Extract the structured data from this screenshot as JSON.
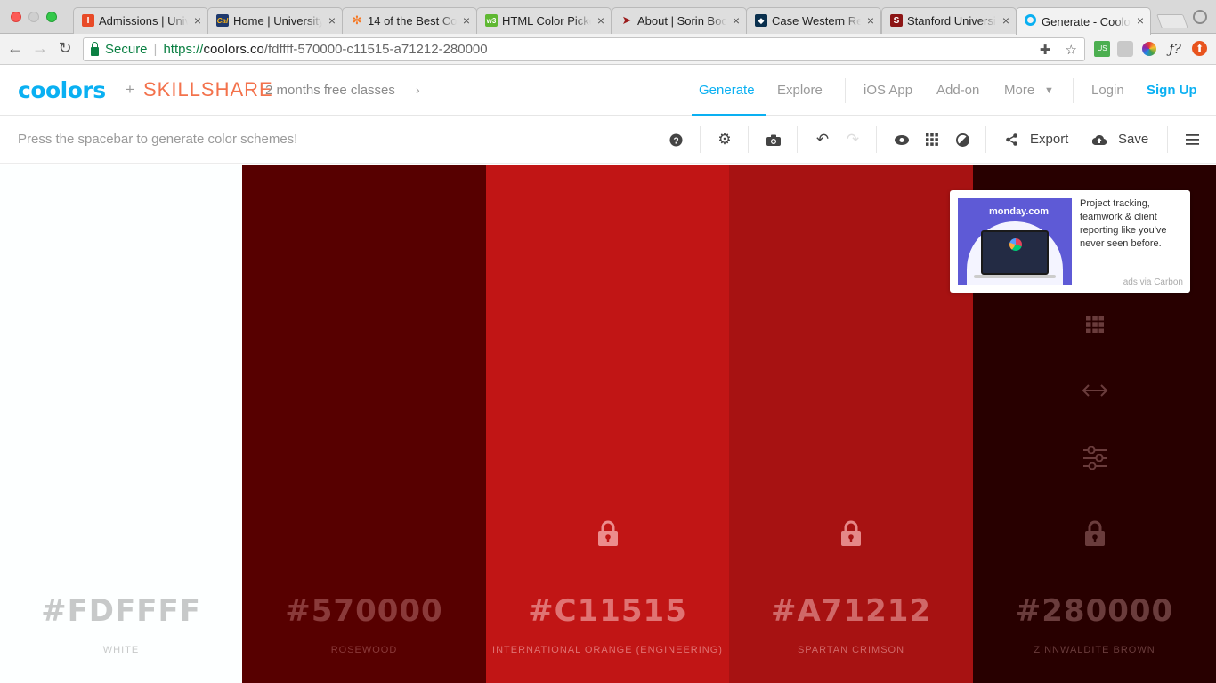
{
  "browser": {
    "tabs": [
      {
        "title": "Admissions | Univ",
        "favicon_color": "#e84a27",
        "favicon_glyph": "I"
      },
      {
        "title": "Home | University",
        "favicon_color": "#1f3a6e",
        "favicon_glyph": "Cal"
      },
      {
        "title": "14 of the Best Co",
        "favicon_color": "#f57722",
        "favicon_glyph": "hubspot-icon"
      },
      {
        "title": "HTML Color Picke",
        "favicon_color": "#5fb832",
        "favicon_glyph": "w3"
      },
      {
        "title": "About | Sorin Boo",
        "favicon_color": "#9b1b1b",
        "favicon_glyph": "bird-icon"
      },
      {
        "title": "Case Western Re",
        "favicon_color": "#0a304e",
        "favicon_glyph": "cwru-icon"
      },
      {
        "title": "Stanford Universi",
        "favicon_color": "#8c1515",
        "favicon_glyph": "S"
      },
      {
        "title": "Generate - Coolo",
        "favicon_color": "#0ab0f2",
        "favicon_glyph": "coolors-icon"
      }
    ],
    "active_tab_index": 7,
    "address": {
      "secure_label": "Secure",
      "scheme": "https://",
      "host": "coolors.co",
      "path": "/fdffff-570000-c11515-a71212-280000"
    }
  },
  "site": {
    "logo": "coolors",
    "plus": "+",
    "partner": "SKILLSHARE",
    "promo": "2 months free classes",
    "nav": {
      "generate": "Generate",
      "explore": "Explore",
      "ios": "iOS App",
      "addon": "Add-on",
      "more": "More",
      "login": "Login",
      "signup": "Sign Up"
    },
    "accent": "#0ab0f2"
  },
  "toolbar": {
    "hint": "Press the spacebar to generate color schemes!",
    "export_label": "Export",
    "save_label": "Save",
    "icons": [
      "help-icon",
      "settings-icon",
      "camera-icon",
      "undo-icon",
      "redo-icon",
      "eye-icon",
      "grid-icon",
      "adjust-icon",
      "share-icon",
      "upload-icon",
      "menu-icon"
    ]
  },
  "palette": [
    {
      "hex": "#FDFFFF",
      "name": "WHITE",
      "color": "#fdffff",
      "text_color": "#c7c9c9",
      "locked": false
    },
    {
      "hex": "#570000",
      "name": "ROSEWOOD",
      "color": "#570000",
      "text_color": "#8a3a3a",
      "locked": false
    },
    {
      "hex": "#C11515",
      "name": "INTERNATIONAL ORANGE (ENGINEERING)",
      "color": "#c11515",
      "text_color": "#e07373",
      "locked": true
    },
    {
      "hex": "#A71212",
      "name": "SPARTAN CRIMSON",
      "color": "#a71212",
      "text_color": "#d06868",
      "locked": true
    },
    {
      "hex": "#280000",
      "name": "ZINNWALDITE BROWN",
      "color": "#280000",
      "text_color": "#6a3c3c",
      "locked": false
    }
  ],
  "ad": {
    "brand": "monday.com",
    "text": "Project tracking, teamwork & client reporting like you've never seen before.",
    "via": "ads via Carbon"
  }
}
